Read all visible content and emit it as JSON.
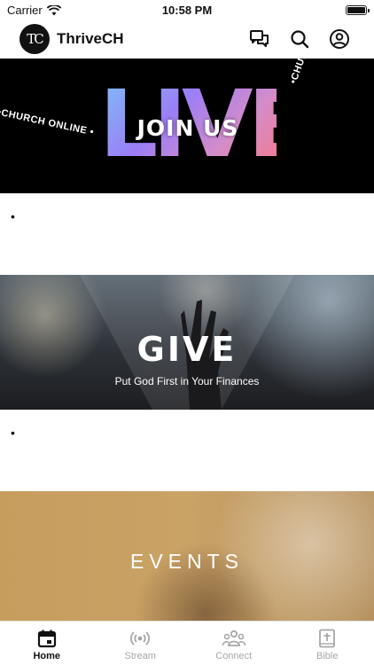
{
  "status_bar": {
    "carrier": "Carrier",
    "time": "10:58 PM"
  },
  "header": {
    "logo_text": "TC",
    "title": "ThriveCH"
  },
  "banners": {
    "live": {
      "headline": "LIVE",
      "overlay": "JOIN US",
      "ring_left": "•CHURCH ONLINE •",
      "ring_right": "•CHURCH ONLINE •C"
    },
    "give": {
      "title": "GIVE",
      "subtitle": "Put God First in Your Finances"
    },
    "events": {
      "title": "EVENTS"
    }
  },
  "bullets": [
    "•",
    "•"
  ],
  "tabs": [
    {
      "label": "Home",
      "icon": "calendar-icon",
      "active": true
    },
    {
      "label": "Stream",
      "icon": "broadcast-icon",
      "active": false
    },
    {
      "label": "Connect",
      "icon": "people-icon",
      "active": false
    },
    {
      "label": "Bible",
      "icon": "bible-icon",
      "active": false
    }
  ],
  "colors": {
    "active_tab": "#111111",
    "inactive_tab": "#a7a7a7"
  }
}
